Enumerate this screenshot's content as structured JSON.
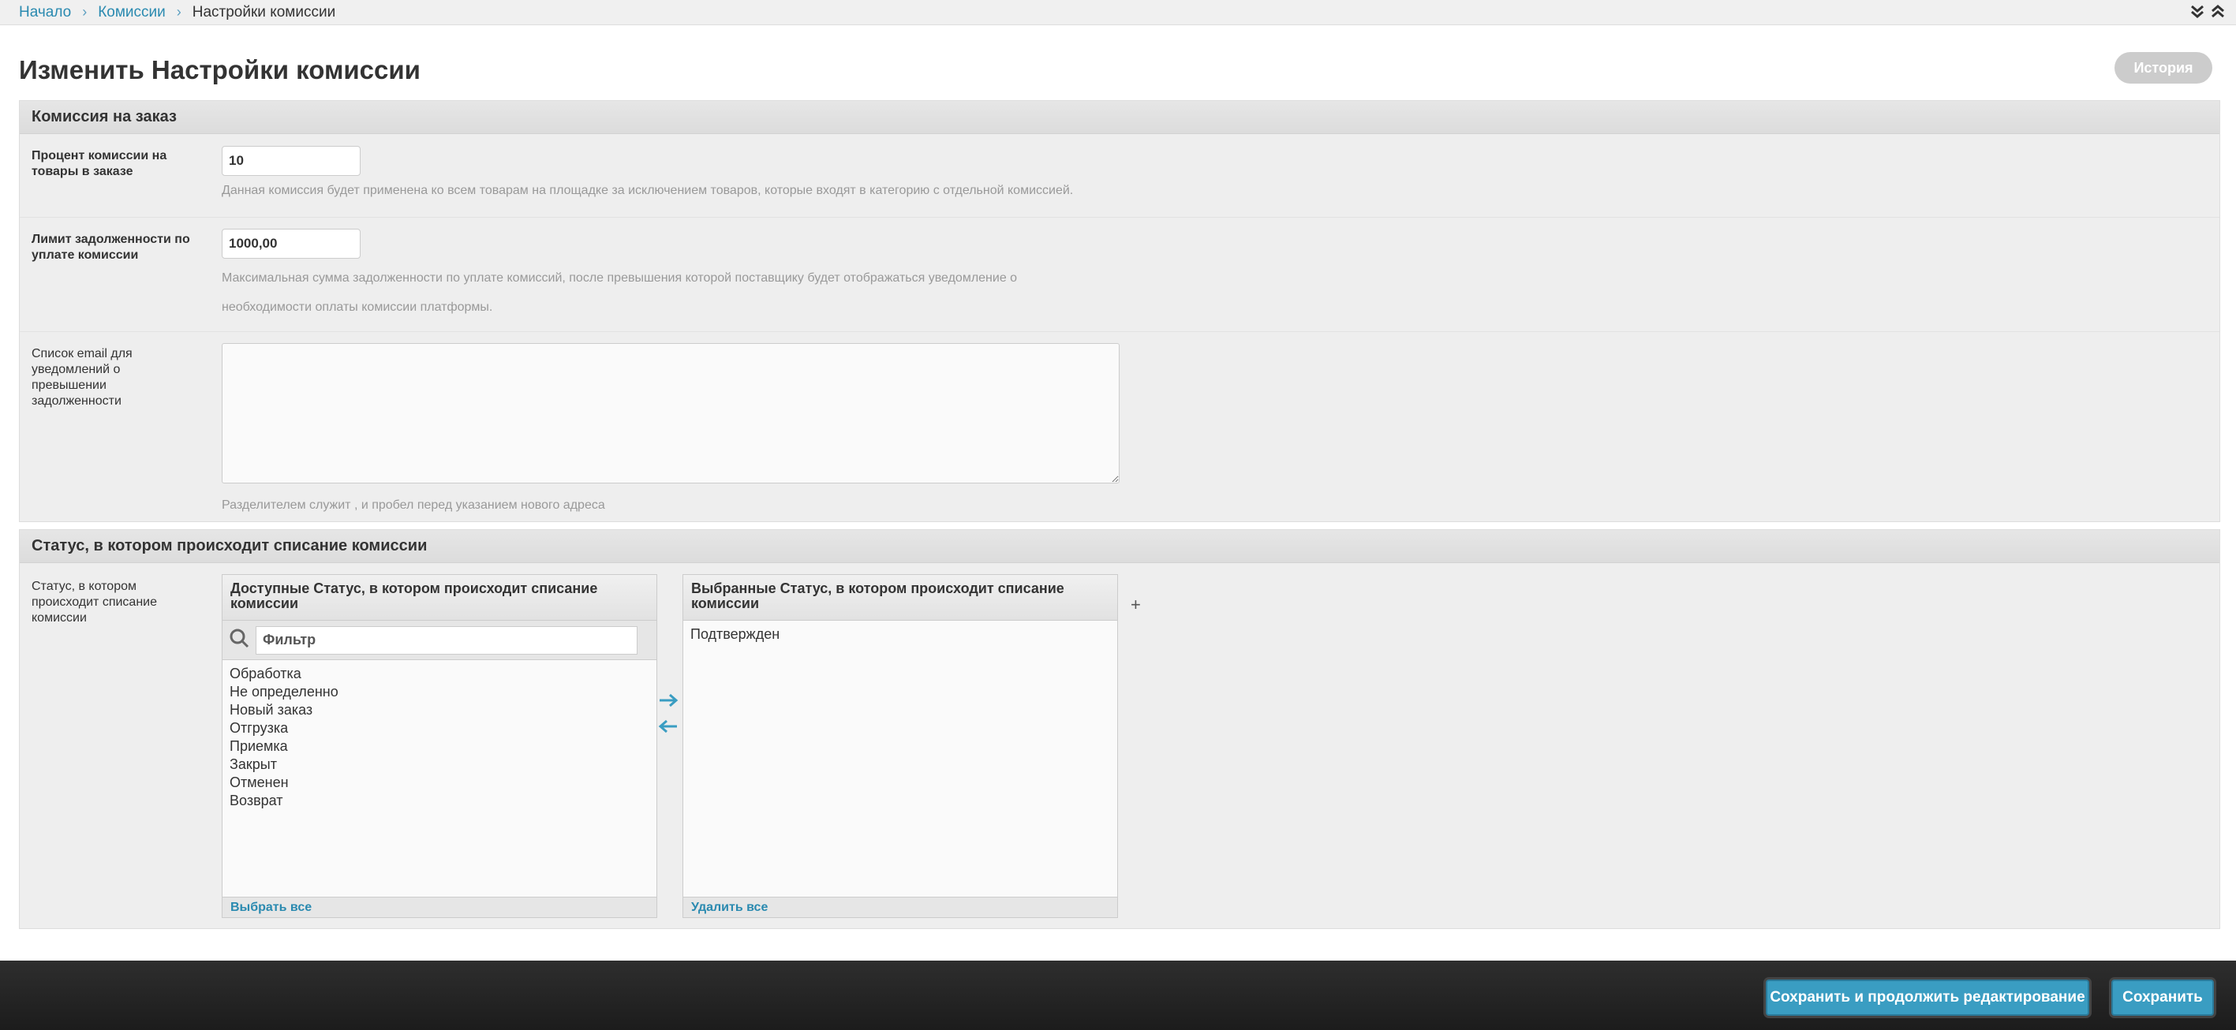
{
  "breadcrumbs": {
    "home": "Начало",
    "section": "Комиссии",
    "current": "Настройки комиссии"
  },
  "page": {
    "title": "Изменить Настройки комиссии",
    "history_button": "История"
  },
  "fieldset_order": {
    "header": "Комиссия на заказ",
    "percent_label": "Процент комиссии на товары в заказе",
    "percent_value": "10",
    "percent_help": "Данная комиссия будет применена ко всем товарам на площадке за исключением товаров, которые входят в категорию с отдельной комиссией.",
    "limit_label": "Лимит задолженности по уплате комиссии",
    "limit_value": "1000,00",
    "limit_help_line1": "Максимальная сумма задолженности по уплате комиссий, после превышения которой поставщику будет отображаться уведомление о",
    "limit_help_line2": "необходимости оплаты комиссии платформы.",
    "emails_label": "Список email для уведомлений о превышении задолженности",
    "emails_value": "",
    "emails_help": "Разделителем служит , и пробел перед указанием нового адреса"
  },
  "fieldset_status": {
    "header": "Статус, в котором происходит списание комиссии",
    "field_label": "Статус, в котором происходит списание комиссии",
    "available_title": "Доступные Статус, в котором происходит списание комиссии",
    "filter_placeholder": "Фильтр",
    "available_options": [
      "Обработка",
      "Не определенно",
      "Новый заказ",
      "Отгрузка",
      "Приемка",
      "Закрыт",
      "Отменен",
      "Возврат"
    ],
    "choose_all": "Выбрать все",
    "chosen_title": "Выбранные Статус, в котором происходит списание комиссии",
    "chosen_options": [
      "Подтвержден"
    ],
    "remove_all": "Удалить все",
    "add_symbol": "+"
  },
  "submit": {
    "save_continue": "Сохранить и продолжить редактирование",
    "save": "Сохранить"
  },
  "colors": {
    "link": "#2a8ab0",
    "button": "#3a9dc2",
    "footer_bg": "#1c1c1c"
  }
}
